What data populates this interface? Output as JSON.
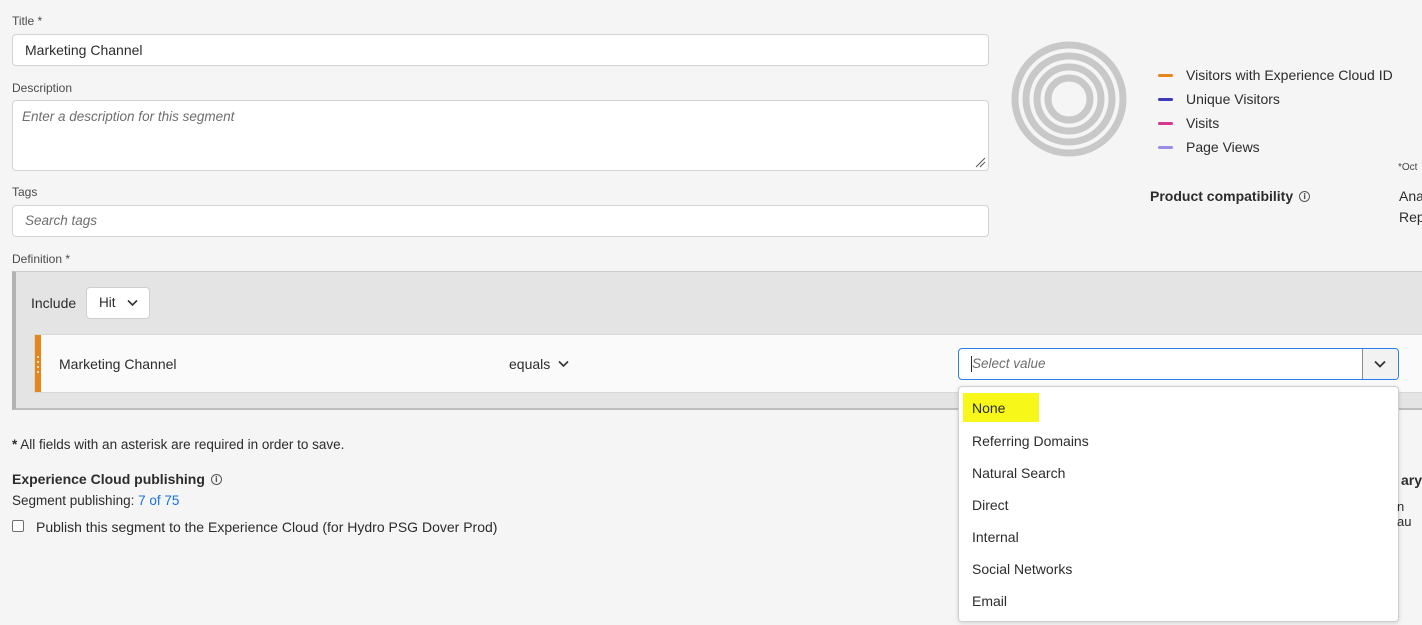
{
  "form": {
    "title_label": "Title *",
    "title_value": "Marketing Channel",
    "description_label": "Description",
    "description_placeholder": "Enter a description for this segment",
    "tags_label": "Tags",
    "tags_placeholder": "Search tags",
    "definition_label": "Definition *"
  },
  "definition": {
    "include_label": "Include",
    "container_value": "Hit",
    "rule": {
      "dimension": "Marketing Channel",
      "operator": "equals",
      "value_placeholder": "Select value"
    }
  },
  "dropdown": {
    "options": [
      "None",
      "Referring Domains",
      "Natural Search",
      "Direct",
      "Internal",
      "Social Networks",
      "Email"
    ],
    "highlighted_option": "None",
    "highlight_color": "#f7f81a"
  },
  "summary": {
    "legend": [
      {
        "label": "Visitors with Experience Cloud ID",
        "color": "#e68619"
      },
      {
        "label": "Unique Visitors",
        "color": "#3d3ab8"
      },
      {
        "label": "Visits",
        "color": "#d83790"
      },
      {
        "label": "Page Views",
        "color": "#9b8ce8"
      }
    ],
    "date_note": "*Oct",
    "product_compatibility_label": "Product compatibility",
    "compat_line1": "Ana",
    "compat_line2": "Rep"
  },
  "footer": {
    "required_note": "All fields with an asterisk are required in order to save.",
    "required_star": "*",
    "publishing_heading": "Experience Cloud publishing",
    "segment_publishing_label": "Segment publishing:",
    "segment_publishing_count": "7 of 75",
    "publish_checkbox_label": "Publish this segment to the Experience Cloud (for Hydro PSG Dover Prod)",
    "right_partial_1": "ary",
    "right_partial_2": "n au"
  },
  "colors": {
    "accent_blue": "#2680eb",
    "drag_handle": "#e68619",
    "link": "#1473e6"
  }
}
